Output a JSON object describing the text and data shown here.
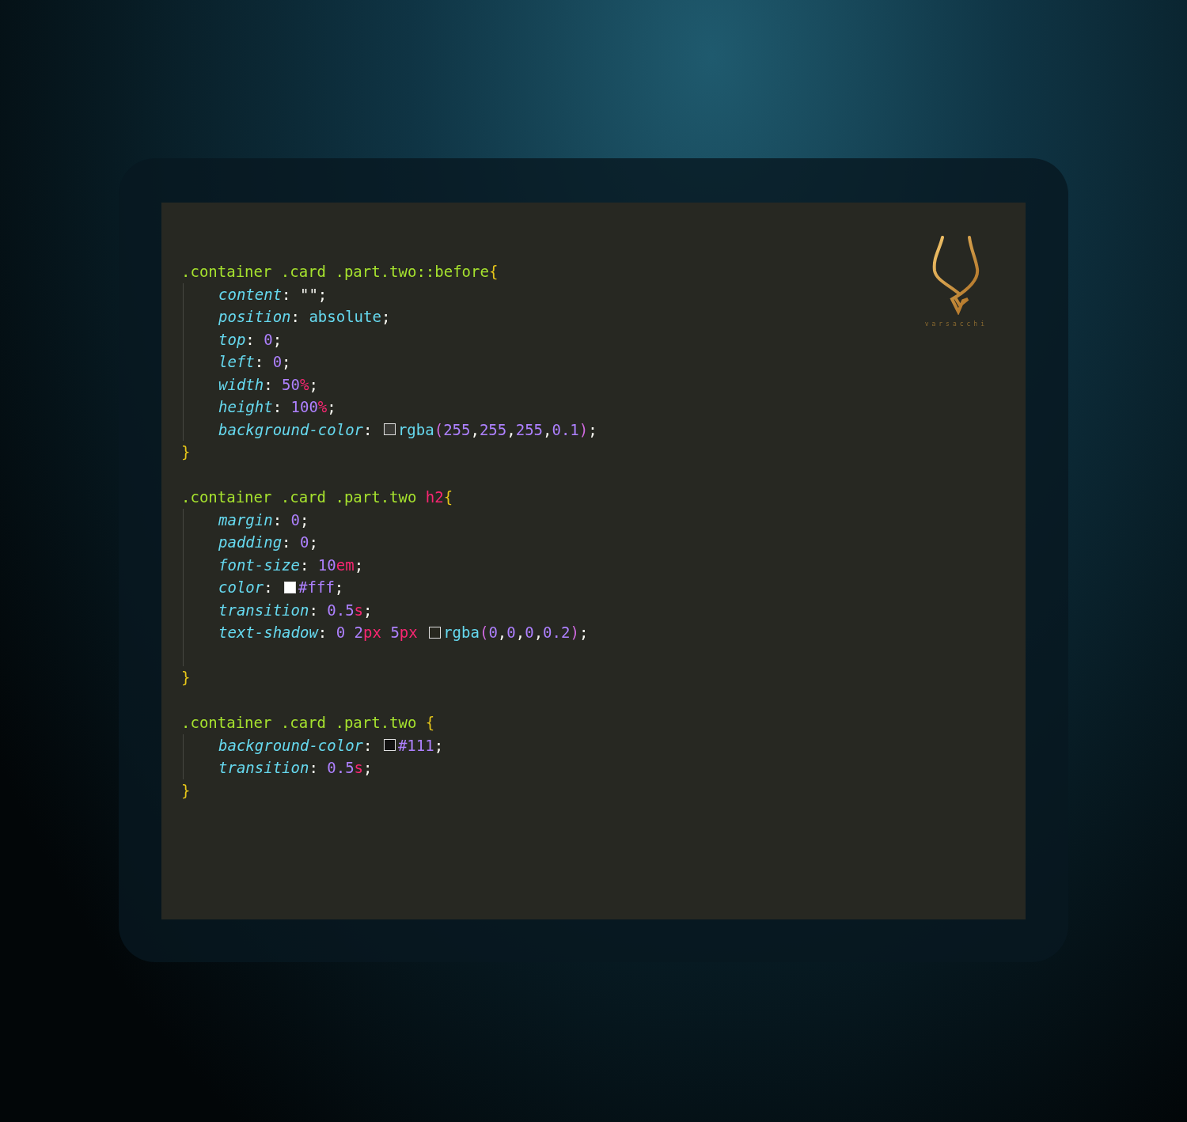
{
  "logo": {
    "text": "varsacchi"
  },
  "rules": [
    {
      "selector": [
        {
          "kind": "selector",
          "text": ".container .card .part.two::before"
        },
        {
          "kind": "brace",
          "text": "{"
        }
      ],
      "body": [
        {
          "kind": "decl",
          "tokens": [
            {
              "kind": "property",
              "text": "content"
            },
            {
              "kind": "punct",
              "text": ": "
            },
            {
              "kind": "string",
              "text": "\"\""
            },
            {
              "kind": "punct",
              "text": ";"
            }
          ]
        },
        {
          "kind": "decl",
          "tokens": [
            {
              "kind": "property",
              "text": "position"
            },
            {
              "kind": "punct",
              "text": ": "
            },
            {
              "kind": "keyword",
              "text": "absolute"
            },
            {
              "kind": "punct",
              "text": ";"
            }
          ]
        },
        {
          "kind": "decl",
          "tokens": [
            {
              "kind": "property",
              "text": "top"
            },
            {
              "kind": "punct",
              "text": ": "
            },
            {
              "kind": "number",
              "text": "0"
            },
            {
              "kind": "punct",
              "text": ";"
            }
          ]
        },
        {
          "kind": "decl",
          "tokens": [
            {
              "kind": "property",
              "text": "left"
            },
            {
              "kind": "punct",
              "text": ": "
            },
            {
              "kind": "number",
              "text": "0"
            },
            {
              "kind": "punct",
              "text": ";"
            }
          ]
        },
        {
          "kind": "decl",
          "tokens": [
            {
              "kind": "property",
              "text": "width"
            },
            {
              "kind": "punct",
              "text": ": "
            },
            {
              "kind": "number",
              "text": "50"
            },
            {
              "kind": "unit",
              "text": "%"
            },
            {
              "kind": "punct",
              "text": ";"
            }
          ]
        },
        {
          "kind": "decl",
          "tokens": [
            {
              "kind": "property",
              "text": "height"
            },
            {
              "kind": "punct",
              "text": ": "
            },
            {
              "kind": "number",
              "text": "100"
            },
            {
              "kind": "unit",
              "text": "%"
            },
            {
              "kind": "punct",
              "text": ";"
            }
          ]
        },
        {
          "kind": "decl",
          "tokens": [
            {
              "kind": "property",
              "text": "background-color"
            },
            {
              "kind": "punct",
              "text": ": "
            },
            {
              "kind": "swatch",
              "color": "#3a3a36"
            },
            {
              "kind": "keyword",
              "text": "rgba"
            },
            {
              "kind": "paren",
              "text": "("
            },
            {
              "kind": "number",
              "text": "255"
            },
            {
              "kind": "punct",
              "text": ","
            },
            {
              "kind": "number",
              "text": "255"
            },
            {
              "kind": "punct",
              "text": ","
            },
            {
              "kind": "number",
              "text": "255"
            },
            {
              "kind": "punct",
              "text": ","
            },
            {
              "kind": "number",
              "text": "0.1"
            },
            {
              "kind": "paren",
              "text": ")"
            },
            {
              "kind": "punct",
              "text": ";"
            }
          ]
        }
      ],
      "close": [
        {
          "kind": "brace",
          "text": "}"
        }
      ]
    },
    {
      "selector": [
        {
          "kind": "selector",
          "text": ".container .card .part.two "
        },
        {
          "kind": "tag",
          "text": "h2"
        },
        {
          "kind": "brace",
          "text": "{"
        }
      ],
      "body": [
        {
          "kind": "decl",
          "tokens": [
            {
              "kind": "property",
              "text": "margin"
            },
            {
              "kind": "punct",
              "text": ": "
            },
            {
              "kind": "number",
              "text": "0"
            },
            {
              "kind": "punct",
              "text": ";"
            }
          ]
        },
        {
          "kind": "decl",
          "tokens": [
            {
              "kind": "property",
              "text": "padding"
            },
            {
              "kind": "punct",
              "text": ": "
            },
            {
              "kind": "number",
              "text": "0"
            },
            {
              "kind": "punct",
              "text": ";"
            }
          ]
        },
        {
          "kind": "decl",
          "tokens": [
            {
              "kind": "property",
              "text": "font-size"
            },
            {
              "kind": "punct",
              "text": ": "
            },
            {
              "kind": "number",
              "text": "10"
            },
            {
              "kind": "unit",
              "text": "em"
            },
            {
              "kind": "punct",
              "text": ";"
            }
          ]
        },
        {
          "kind": "decl",
          "tokens": [
            {
              "kind": "property",
              "text": "color"
            },
            {
              "kind": "punct",
              "text": ": "
            },
            {
              "kind": "swatch",
              "color": "#ffffff"
            },
            {
              "kind": "number",
              "text": "#fff"
            },
            {
              "kind": "punct",
              "text": ";"
            }
          ]
        },
        {
          "kind": "decl",
          "tokens": [
            {
              "kind": "property",
              "text": "transition"
            },
            {
              "kind": "punct",
              "text": ": "
            },
            {
              "kind": "number",
              "text": "0.5"
            },
            {
              "kind": "unit",
              "text": "s"
            },
            {
              "kind": "punct",
              "text": ";"
            }
          ]
        },
        {
          "kind": "decl",
          "tokens": [
            {
              "kind": "property",
              "text": "text-shadow"
            },
            {
              "kind": "punct",
              "text": ": "
            },
            {
              "kind": "number",
              "text": "0 2"
            },
            {
              "kind": "unit",
              "text": "px "
            },
            {
              "kind": "number",
              "text": "5"
            },
            {
              "kind": "unit",
              "text": "px "
            },
            {
              "kind": "swatch",
              "color": "#27271f"
            },
            {
              "kind": "keyword",
              "text": "rgba"
            },
            {
              "kind": "paren",
              "text": "("
            },
            {
              "kind": "number",
              "text": "0"
            },
            {
              "kind": "punct",
              "text": ","
            },
            {
              "kind": "number",
              "text": "0"
            },
            {
              "kind": "punct",
              "text": ","
            },
            {
              "kind": "number",
              "text": "0"
            },
            {
              "kind": "punct",
              "text": ","
            },
            {
              "kind": "number",
              "text": "0.2"
            },
            {
              "kind": "paren",
              "text": ")"
            },
            {
              "kind": "punct",
              "text": ";"
            }
          ]
        },
        {
          "kind": "blank"
        }
      ],
      "close": [
        {
          "kind": "brace",
          "text": "}"
        }
      ]
    },
    {
      "selector": [
        {
          "kind": "selector",
          "text": ".container .card .part.two "
        },
        {
          "kind": "brace",
          "text": "{"
        }
      ],
      "body": [
        {
          "kind": "decl",
          "tokens": [
            {
              "kind": "property",
              "text": "background-color"
            },
            {
              "kind": "punct",
              "text": ": "
            },
            {
              "kind": "swatch",
              "color": "#111111"
            },
            {
              "kind": "number",
              "text": "#111"
            },
            {
              "kind": "punct",
              "text": ";"
            }
          ]
        },
        {
          "kind": "decl",
          "tokens": [
            {
              "kind": "property",
              "text": "transition"
            },
            {
              "kind": "punct",
              "text": ": "
            },
            {
              "kind": "number",
              "text": "0.5"
            },
            {
              "kind": "unit",
              "text": "s"
            },
            {
              "kind": "punct",
              "text": ";"
            }
          ]
        }
      ],
      "close": [
        {
          "kind": "brace",
          "text": "}"
        }
      ]
    }
  ]
}
